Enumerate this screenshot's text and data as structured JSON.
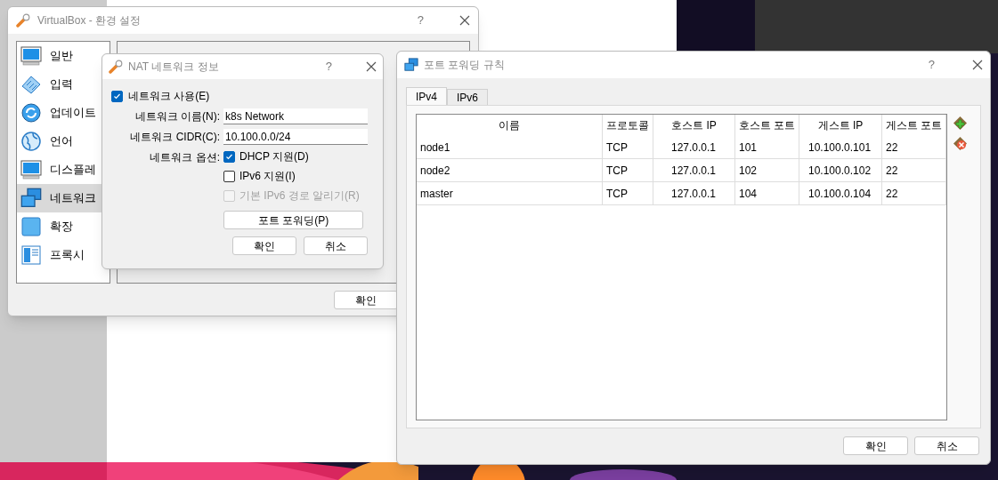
{
  "settings_window": {
    "title": "VirtualBox - 환경 설정",
    "help": "?",
    "sidebar": {
      "items": [
        {
          "label": "일반",
          "kind": "display",
          "selected": false
        },
        {
          "label": "입력",
          "kind": "keyboard",
          "selected": false
        },
        {
          "label": "업데이트",
          "kind": "update",
          "selected": false
        },
        {
          "label": "언어",
          "kind": "globe",
          "selected": false
        },
        {
          "label": "디스플레",
          "kind": "display",
          "selected": false
        },
        {
          "label": "네트워크",
          "kind": "network",
          "selected": true
        },
        {
          "label": "확장",
          "kind": "extension",
          "selected": false
        },
        {
          "label": "프록시",
          "kind": "proxy",
          "selected": false
        }
      ]
    },
    "buttons": [
      "확인"
    ]
  },
  "nat_dialog": {
    "title": "NAT 네트워크 정보",
    "help": "?",
    "enable": {
      "label": "네트워크 사용(E)",
      "checked": true
    },
    "fields": [
      {
        "label": "네트워크 이름(N):",
        "value": "k8s Network"
      },
      {
        "label": "네트워크 CIDR(C):",
        "value": "10.100.0.0/24"
      }
    ],
    "options_label": "네트워크 옵션:",
    "options": [
      {
        "label": "DHCP 지원(D)",
        "checked": true,
        "disabled": false
      },
      {
        "label": "IPv6 지원(I)",
        "checked": false,
        "disabled": false
      },
      {
        "label": "기본 IPv6 경로 알리기(R)",
        "checked": false,
        "disabled": true
      }
    ],
    "port_forwarding_button": "포트 포워딩(P)",
    "buttons": [
      "확인",
      "취소"
    ]
  },
  "port_forwarding_window": {
    "title": "포트 포워딩 규칙",
    "help": "?",
    "tabs": [
      {
        "label": "IPv4",
        "selected": true
      },
      {
        "label": "IPv6",
        "selected": false
      }
    ],
    "table": {
      "columns": [
        "이름",
        "프로토콜",
        "호스트 IP",
        "호스트 포트",
        "게스트 IP",
        "게스트 포트"
      ],
      "rows": [
        [
          "node1",
          "TCP",
          "127.0.0.1",
          "101",
          "10.100.0.101",
          "22"
        ],
        [
          "node2",
          "TCP",
          "127.0.0.1",
          "102",
          "10.100.0.102",
          "22"
        ],
        [
          "master",
          "TCP",
          "127.0.0.1",
          "104",
          "10.100.0.104",
          "22"
        ]
      ]
    },
    "buttons": [
      "확인",
      "취소"
    ]
  }
}
